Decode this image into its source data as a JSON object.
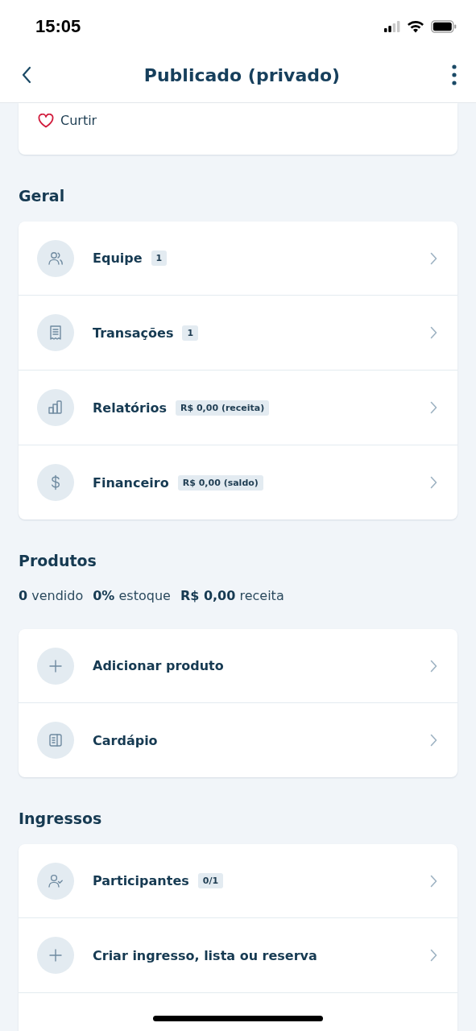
{
  "status_bar": {
    "time": "15:05"
  },
  "header": {
    "title": "Publicado (privado)"
  },
  "like": {
    "label": "Curtir"
  },
  "sections": [
    {
      "title": "Geral",
      "items": [
        {
          "kind": "team",
          "label": "Equipe",
          "badge": "1"
        },
        {
          "kind": "receipt",
          "label": "Transações",
          "badge": "1"
        },
        {
          "kind": "chart",
          "label": "Relatórios",
          "badge": "R$ 0,00 (receita)"
        },
        {
          "kind": "money",
          "label": "Financeiro",
          "badge": "R$ 0,00 (saldo)"
        }
      ]
    },
    {
      "title": "Produtos",
      "stats": [
        "**0** vendido",
        "**0%** estoque",
        "**R$ 0,00** receita"
      ],
      "items": [
        {
          "kind": "add",
          "label": "Adicionar produto"
        },
        {
          "kind": "menu",
          "label": "Cardápio"
        }
      ]
    },
    {
      "title": "Ingressos",
      "items": [
        {
          "kind": "attendee",
          "label": "Participantes",
          "badge": "0/1"
        },
        {
          "kind": "add",
          "label": "Criar ingresso, lista ou reserva"
        },
        {
          "kind": "blank"
        }
      ]
    }
  ]
}
